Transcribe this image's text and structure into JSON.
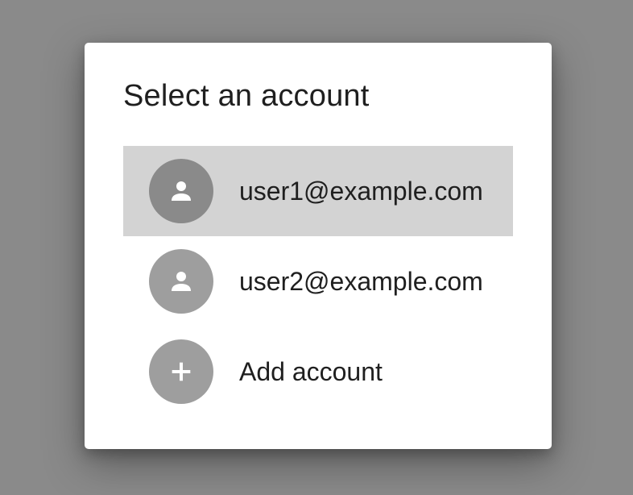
{
  "dialog": {
    "title": "Select an account",
    "accounts": [
      {
        "label": "user1@example.com",
        "icon": "person-icon",
        "selected": true
      },
      {
        "label": "user2@example.com",
        "icon": "person-icon",
        "selected": false
      }
    ],
    "add_account": {
      "label": "Add account",
      "icon": "plus-icon"
    }
  },
  "colors": {
    "scrim": "#8a8a8a",
    "dialog_bg": "#ffffff",
    "selected_row_bg": "#d3d3d3",
    "avatar_bg": "#9e9e9e",
    "selected_avatar_bg": "#8a8a8a",
    "text": "#1f1f1f"
  }
}
